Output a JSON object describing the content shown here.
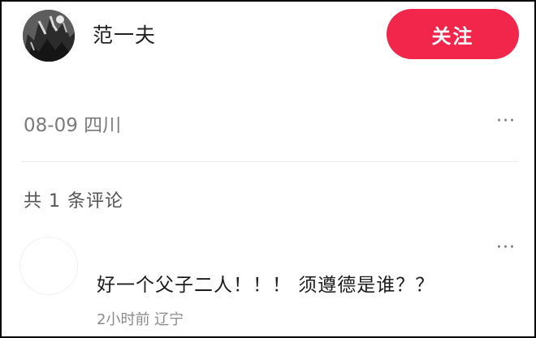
{
  "author": {
    "name": "范一夫",
    "follow_label": "关注"
  },
  "post": {
    "meta": "08-09 四川",
    "more_glyph": "···"
  },
  "comments_section": {
    "count_label": "共 1 条评论"
  },
  "comments": [
    {
      "text": "好一个父子二人！！！ 须遵德是谁？？",
      "meta": "2小时前 辽宁",
      "more_glyph": "···"
    }
  ],
  "colors": {
    "follow_button": "#f2254a",
    "meta_text": "#7a7a7a",
    "divider": "#ececec"
  },
  "icons": {
    "post_more": "more-horizontal-icon",
    "comment_more": "more-horizontal-icon"
  }
}
